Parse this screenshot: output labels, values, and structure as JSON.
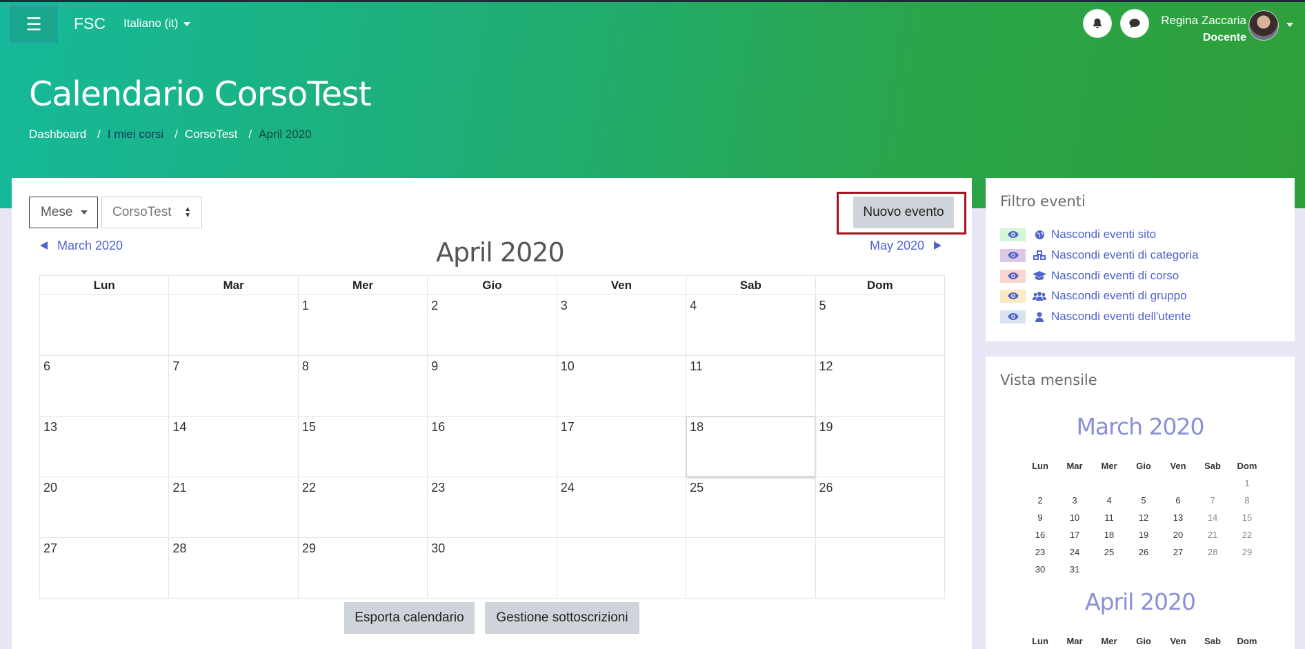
{
  "navbar": {
    "brand": "FSC",
    "language": "Italiano (it)",
    "user_name": "Regina Zaccaria",
    "user_role": "Docente"
  },
  "page": {
    "title": "Calendario CorsoTest",
    "breadcrumb": [
      "Dashboard",
      "I miei corsi",
      "CorsoTest",
      "April 2020"
    ]
  },
  "calendar": {
    "view_select": "Mese",
    "course_select": "CorsoTest",
    "new_event_label": "Nuovo evento",
    "prev_month": "March 2020",
    "next_month": "May 2020",
    "month_title": "April 2020",
    "weekdays": [
      "Lun",
      "Mar",
      "Mer",
      "Gio",
      "Ven",
      "Sab",
      "Dom"
    ],
    "weeks": [
      [
        "",
        "",
        "1",
        "2",
        "3",
        "4",
        "5"
      ],
      [
        "6",
        "7",
        "8",
        "9",
        "10",
        "11",
        "12"
      ],
      [
        "13",
        "14",
        "15",
        "16",
        "17",
        "18",
        "19"
      ],
      [
        "20",
        "21",
        "22",
        "23",
        "24",
        "25",
        "26"
      ],
      [
        "27",
        "28",
        "29",
        "30",
        "",
        "",
        ""
      ]
    ],
    "today": "18",
    "export_label": "Esporta calendario",
    "subscriptions_label": "Gestione sottoscrizioni"
  },
  "filter": {
    "title": "Filtro eventi",
    "items": [
      {
        "label": "Nascondi eventi sito",
        "color": "#d4f5d6",
        "icon": "globe-icon"
      },
      {
        "label": "Nascondi eventi di categoria",
        "color": "#dcc8e6",
        "icon": "cubes-icon"
      },
      {
        "label": "Nascondi eventi di corso",
        "color": "#fbd4cf",
        "icon": "graduation-cap-icon"
      },
      {
        "label": "Nascondi eventi di gruppo",
        "color": "#fbe9c4",
        "icon": "users-icon"
      },
      {
        "label": "Nascondi eventi dell'utente",
        "color": "#d9e3ef",
        "icon": "user-icon"
      }
    ]
  },
  "monthly_view": {
    "title": "Vista mensile",
    "march_title": "March 2020",
    "april_title": "April 2020",
    "weekdays": [
      "Lun",
      "Mar",
      "Mer",
      "Gio",
      "Ven",
      "Sab",
      "Dom"
    ],
    "march_weeks": [
      [
        "",
        "",
        "",
        "",
        "",
        "",
        "1"
      ],
      [
        "2",
        "3",
        "4",
        "5",
        "6",
        "7",
        "8"
      ],
      [
        "9",
        "10",
        "11",
        "12",
        "13",
        "14",
        "15"
      ],
      [
        "16",
        "17",
        "18",
        "19",
        "20",
        "21",
        "22"
      ],
      [
        "23",
        "24",
        "25",
        "26",
        "27",
        "28",
        "29"
      ],
      [
        "30",
        "31",
        "",
        "",
        "",
        "",
        ""
      ]
    ]
  },
  "colors": {
    "link": "#4f64c9",
    "highlight_frame": "#a3121b",
    "header_gradient_start": "#16b99a",
    "header_gradient_end": "#2f9f3a"
  }
}
